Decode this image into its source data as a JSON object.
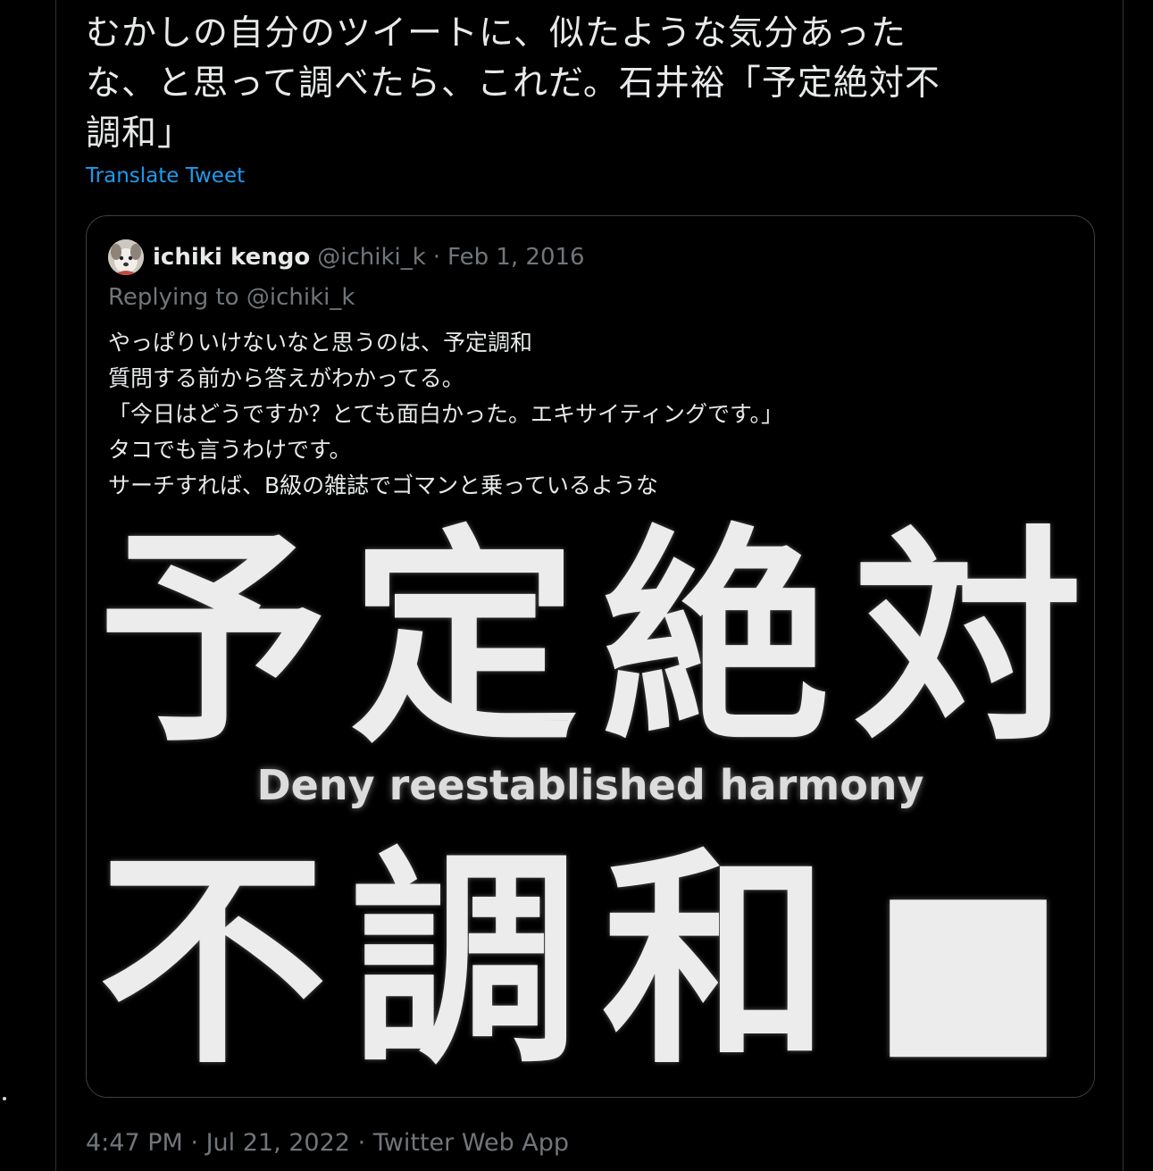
{
  "tweet": {
    "text_line1": "むかしの自分のツイートに、似たような気分あった",
    "text_line2": "な、と思って調べたら、これだ。石井裕「予定絶対不",
    "text_line3": "調和」",
    "translate_label": "Translate Tweet"
  },
  "quoted": {
    "name": "ichiki kengo",
    "handle": "@ichiki_k",
    "separator": "·",
    "date": "Feb 1, 2016",
    "replying": "Replying to @ichiki_k",
    "body": [
      "やっぱりいけないなと思うのは、予定調和",
      "質問する前から答えがわかってる。",
      "「今日はどうですか？とても面白かった。エキサイティングです。」",
      "タコでも言うわけです。",
      "サーチすれば、B級の雑誌でゴマンと乗っているような"
    ],
    "image": {
      "row1": [
        "予",
        "定",
        "絶",
        "対"
      ],
      "subtitle": "Deny reestablished harmony",
      "row2": [
        "不",
        "調",
        "和",
        "■"
      ]
    }
  },
  "footer": {
    "time": "4:47 PM",
    "sep1": "·",
    "date": "Jul 21, 2022",
    "sep2": "·",
    "app": "Twitter Web App"
  },
  "colors": {
    "background": "#000000",
    "text": "#e7e9ea",
    "muted": "#71767b",
    "link": "#1d9bf0",
    "border": "#2f3336"
  }
}
